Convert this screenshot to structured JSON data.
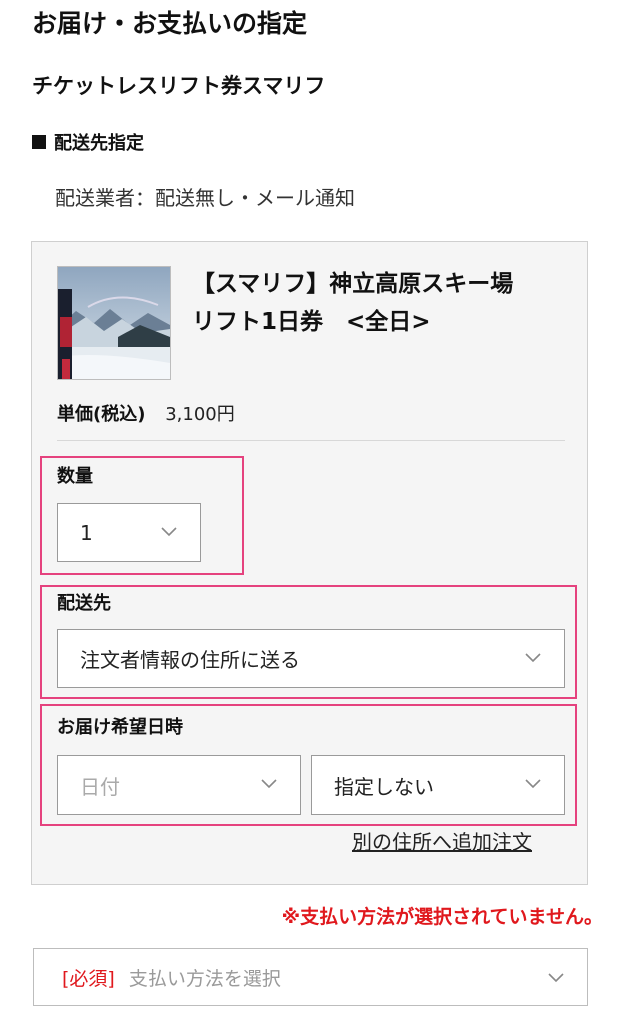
{
  "page": {
    "title": "お届け・お支払いの指定"
  },
  "product_heading": "チケットレスリフト券スマリフ",
  "shipping": {
    "heading": "配送先指定",
    "carrier_text": "配送業者：配送無し・メール通知"
  },
  "item": {
    "name": "【スマリフ】神立高原スキー場　リフト1日券　<全日>",
    "price_label": "単価(税込)",
    "price_value": "3,100円",
    "quantity": {
      "label": "数量",
      "value": "1"
    },
    "destination": {
      "label": "配送先",
      "value": "注文者情報の住所に送る"
    },
    "delivery_datetime": {
      "label": "お届け希望日時",
      "date_placeholder": "日付",
      "time_value": "指定しない"
    },
    "add_order_link": "別の住所へ追加注文"
  },
  "payment": {
    "warning": "※支払い方法が選択されていません。",
    "required_tag": "[必須]",
    "placeholder": "支払い方法を選択"
  },
  "colors": {
    "highlight": "#e5427e",
    "warning_red": "#e0181d",
    "card_bg": "#f5f5f5"
  },
  "icons": {
    "dropdown": "chevron-down-icon"
  }
}
